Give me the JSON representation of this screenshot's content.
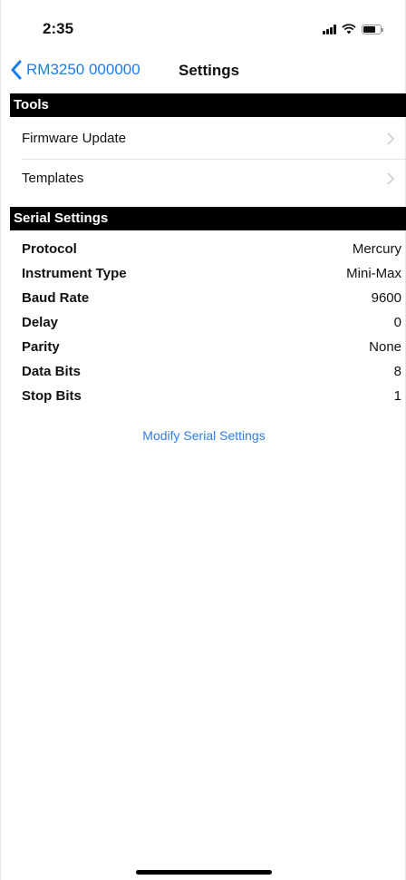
{
  "status_bar": {
    "time": "2:35"
  },
  "nav": {
    "back_label": "RM3250 000000",
    "title": "Settings"
  },
  "sections": {
    "tools": {
      "header": "Tools",
      "items": [
        "Firmware Update",
        "Templates"
      ]
    },
    "serial": {
      "header": "Serial Settings",
      "rows": [
        {
          "label": "Protocol",
          "value": "Mercury"
        },
        {
          "label": "Instrument Type",
          "value": "Mini-Max"
        },
        {
          "label": "Baud Rate",
          "value": "9600"
        },
        {
          "label": "Delay",
          "value": "0"
        },
        {
          "label": "Parity",
          "value": "None"
        },
        {
          "label": "Data Bits",
          "value": "8"
        },
        {
          "label": "Stop Bits",
          "value": "1"
        }
      ]
    }
  },
  "actions": {
    "modify_label": "Modify Serial Settings"
  },
  "colors": {
    "accent": "#1a7cf5",
    "header_bg": "#000000",
    "header_text": "#ffffff"
  },
  "icons": {
    "back": "chevron-left-icon",
    "disclosure": "chevron-right-icon",
    "signal": "signal-icon",
    "wifi": "wifi-icon",
    "battery": "battery-icon"
  }
}
